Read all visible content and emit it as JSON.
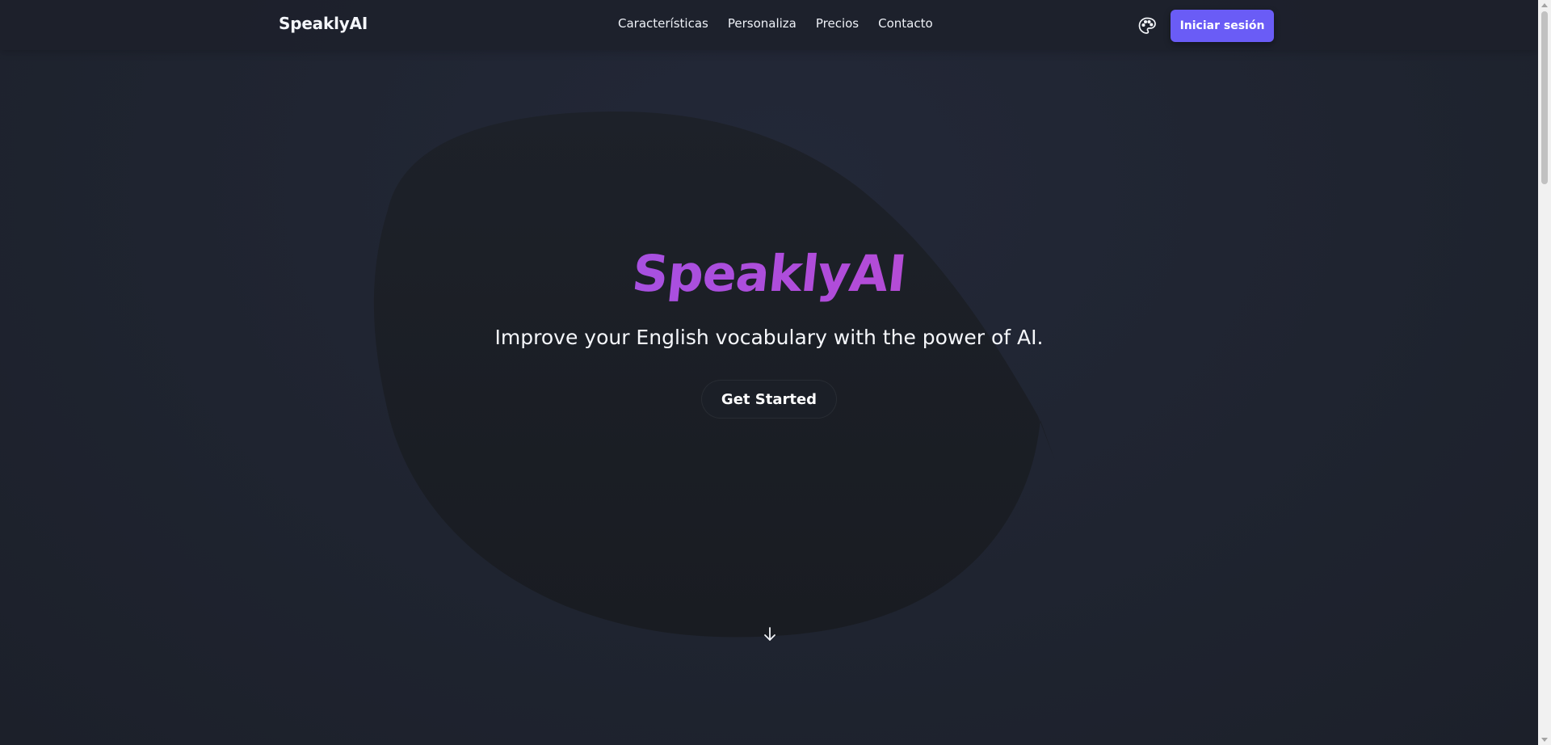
{
  "header": {
    "brand": "SpeaklyAI",
    "nav": [
      "Características",
      "Personaliza",
      "Precios",
      "Contacto"
    ],
    "theme_icon": "palette-icon",
    "login_label": "Iniciar sesión"
  },
  "hero": {
    "logo_text": "SpeaklyAI",
    "subtitle": "Improve your English vocabulary with the power of AI.",
    "cta_label": "Get Started",
    "scroll_icon": "arrow-down-icon"
  },
  "colors": {
    "background": "#1f2430",
    "accent": "#6a5cf6",
    "logo_gradient_start": "#8b5cf6",
    "logo_gradient_end": "#d946ae"
  }
}
